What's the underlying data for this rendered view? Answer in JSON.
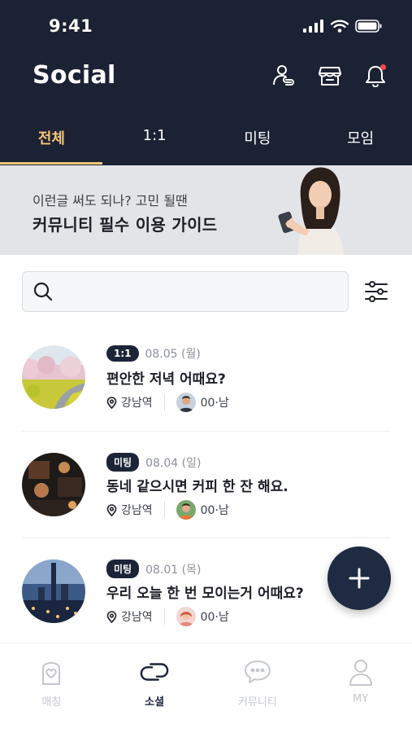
{
  "status": {
    "time": "9:41"
  },
  "header": {
    "title": "Social",
    "actions": [
      "people-link-icon",
      "store-icon",
      "bell-icon"
    ],
    "tabs": [
      {
        "label": "전체",
        "active": true
      },
      {
        "label": "1:1",
        "active": false
      },
      {
        "label": "미팅",
        "active": false
      },
      {
        "label": "모임",
        "active": false
      }
    ]
  },
  "banner": {
    "subtitle": "이런글 써도 되나? 고민 될땐",
    "title": "커뮤니티 필수 이용 가이드"
  },
  "search": {
    "placeholder": ""
  },
  "posts": [
    {
      "badge": "1:1",
      "date": "08.05 (월)",
      "title": "편안한 저녁 어때요?",
      "location": "강남역",
      "user": "00·남"
    },
    {
      "badge": "미팅",
      "date": "08.04 (일)",
      "title": "동네 같으시면 커피 한 잔 해요.",
      "location": "강남역",
      "user": "00·남"
    },
    {
      "badge": "미팅",
      "date": "08.01 (목)",
      "title": "우리 오늘 한 번 모이는거 어때요?",
      "location": "강남역",
      "user": "00·남"
    }
  ],
  "bottom_nav": [
    {
      "label": "매칭",
      "active": false
    },
    {
      "label": "소셜",
      "active": true
    },
    {
      "label": "커뮤니티",
      "active": false
    },
    {
      "label": "MY",
      "active": false
    }
  ],
  "colors": {
    "header_bg": "#1b2234",
    "accent": "#f5c677",
    "badge_bg": "#1c2438",
    "fab_bg": "#1f2b43"
  }
}
